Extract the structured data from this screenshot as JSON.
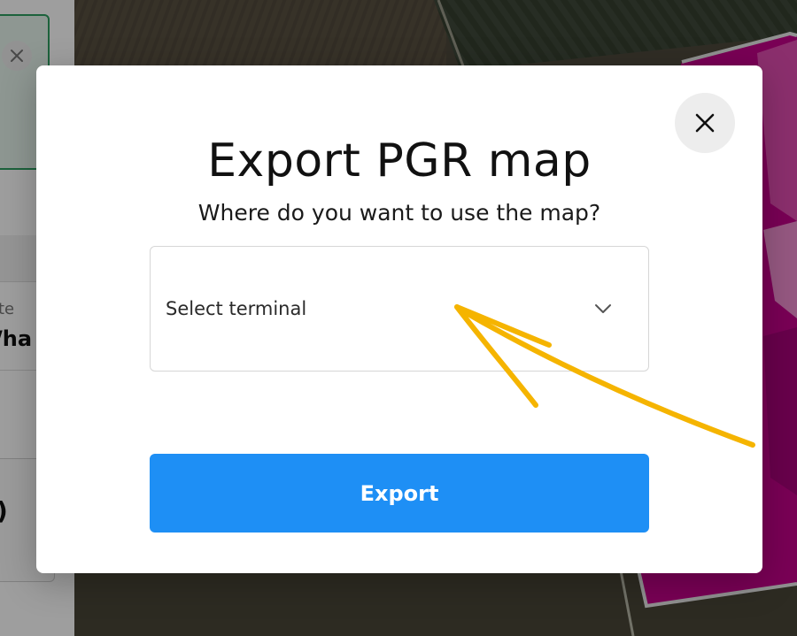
{
  "modal": {
    "title": "Export PGR map",
    "subtitle": "Where do you want to use the map?",
    "select": {
      "placeholder": "Select terminal"
    },
    "export_label": "Export"
  },
  "side_panel": {
    "label_fragment": "te",
    "value_fragment": "/ha",
    "paren_fragment": ")"
  },
  "icons": {
    "close": "close-icon",
    "chevron": "chevron-down-icon",
    "arrow": "annotation-arrow-icon"
  },
  "colors": {
    "accent": "#1e8ff5",
    "annotation": "#f5b400",
    "map_overlay": "#c4008a",
    "panel_border": "#2e9e62"
  }
}
